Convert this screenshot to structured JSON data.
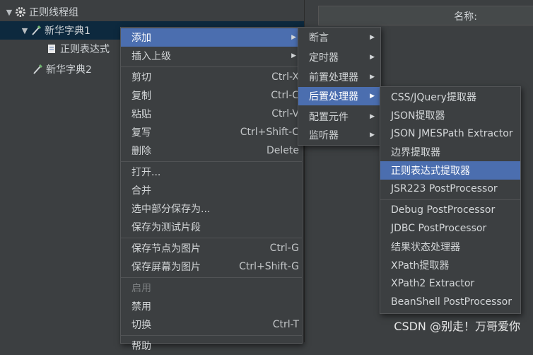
{
  "tree": {
    "items": [
      {
        "label": "正则线程组"
      },
      {
        "label": "新华字典1"
      },
      {
        "label": "正则表达式"
      },
      {
        "label": "新华字典2"
      }
    ]
  },
  "right_panel": {
    "name_label": "名称:"
  },
  "context_menu": {
    "items": [
      {
        "label": "添加",
        "shortcut": ""
      },
      {
        "label": "插入上级",
        "shortcut": ""
      },
      {
        "label": "剪切",
        "shortcut": "Ctrl-X"
      },
      {
        "label": "复制",
        "shortcut": "Ctrl-C"
      },
      {
        "label": "粘贴",
        "shortcut": "Ctrl-V"
      },
      {
        "label": "复写",
        "shortcut": "Ctrl+Shift-C"
      },
      {
        "label": "删除",
        "shortcut": "Delete"
      },
      {
        "label": "打开...",
        "shortcut": ""
      },
      {
        "label": "合并",
        "shortcut": ""
      },
      {
        "label": "选中部分保存为...",
        "shortcut": ""
      },
      {
        "label": "保存为测试片段",
        "shortcut": ""
      },
      {
        "label": "保存节点为图片",
        "shortcut": "Ctrl-G"
      },
      {
        "label": "保存屏幕为图片",
        "shortcut": "Ctrl+Shift-G"
      },
      {
        "label": "启用",
        "shortcut": ""
      },
      {
        "label": "禁用",
        "shortcut": ""
      },
      {
        "label": "切换",
        "shortcut": "Ctrl-T"
      },
      {
        "label": "帮助",
        "shortcut": ""
      }
    ]
  },
  "add_submenu": {
    "items": [
      {
        "label": "断言"
      },
      {
        "label": "定时器"
      },
      {
        "label": "前置处理器"
      },
      {
        "label": "后置处理器"
      },
      {
        "label": "配置元件"
      },
      {
        "label": "监听器"
      }
    ]
  },
  "postprocessor_submenu": {
    "items": [
      {
        "label": "CSS/JQuery提取器"
      },
      {
        "label": "JSON提取器"
      },
      {
        "label": "JSON JMESPath Extractor"
      },
      {
        "label": "边界提取器"
      },
      {
        "label": "正则表达式提取器"
      },
      {
        "label": "JSR223 PostProcessor"
      },
      {
        "label": "Debug PostProcessor"
      },
      {
        "label": "JDBC PostProcessor"
      },
      {
        "label": "结果状态处理器"
      },
      {
        "label": "XPath提取器"
      },
      {
        "label": "XPath2 Extractor"
      },
      {
        "label": "BeanShell PostProcessor"
      }
    ]
  },
  "watermark": "CSDN @别走！万哥爱你",
  "colors": {
    "highlight": "#4b6eaf",
    "tree_selection": "#0d293e",
    "background": "#3c3f41"
  }
}
